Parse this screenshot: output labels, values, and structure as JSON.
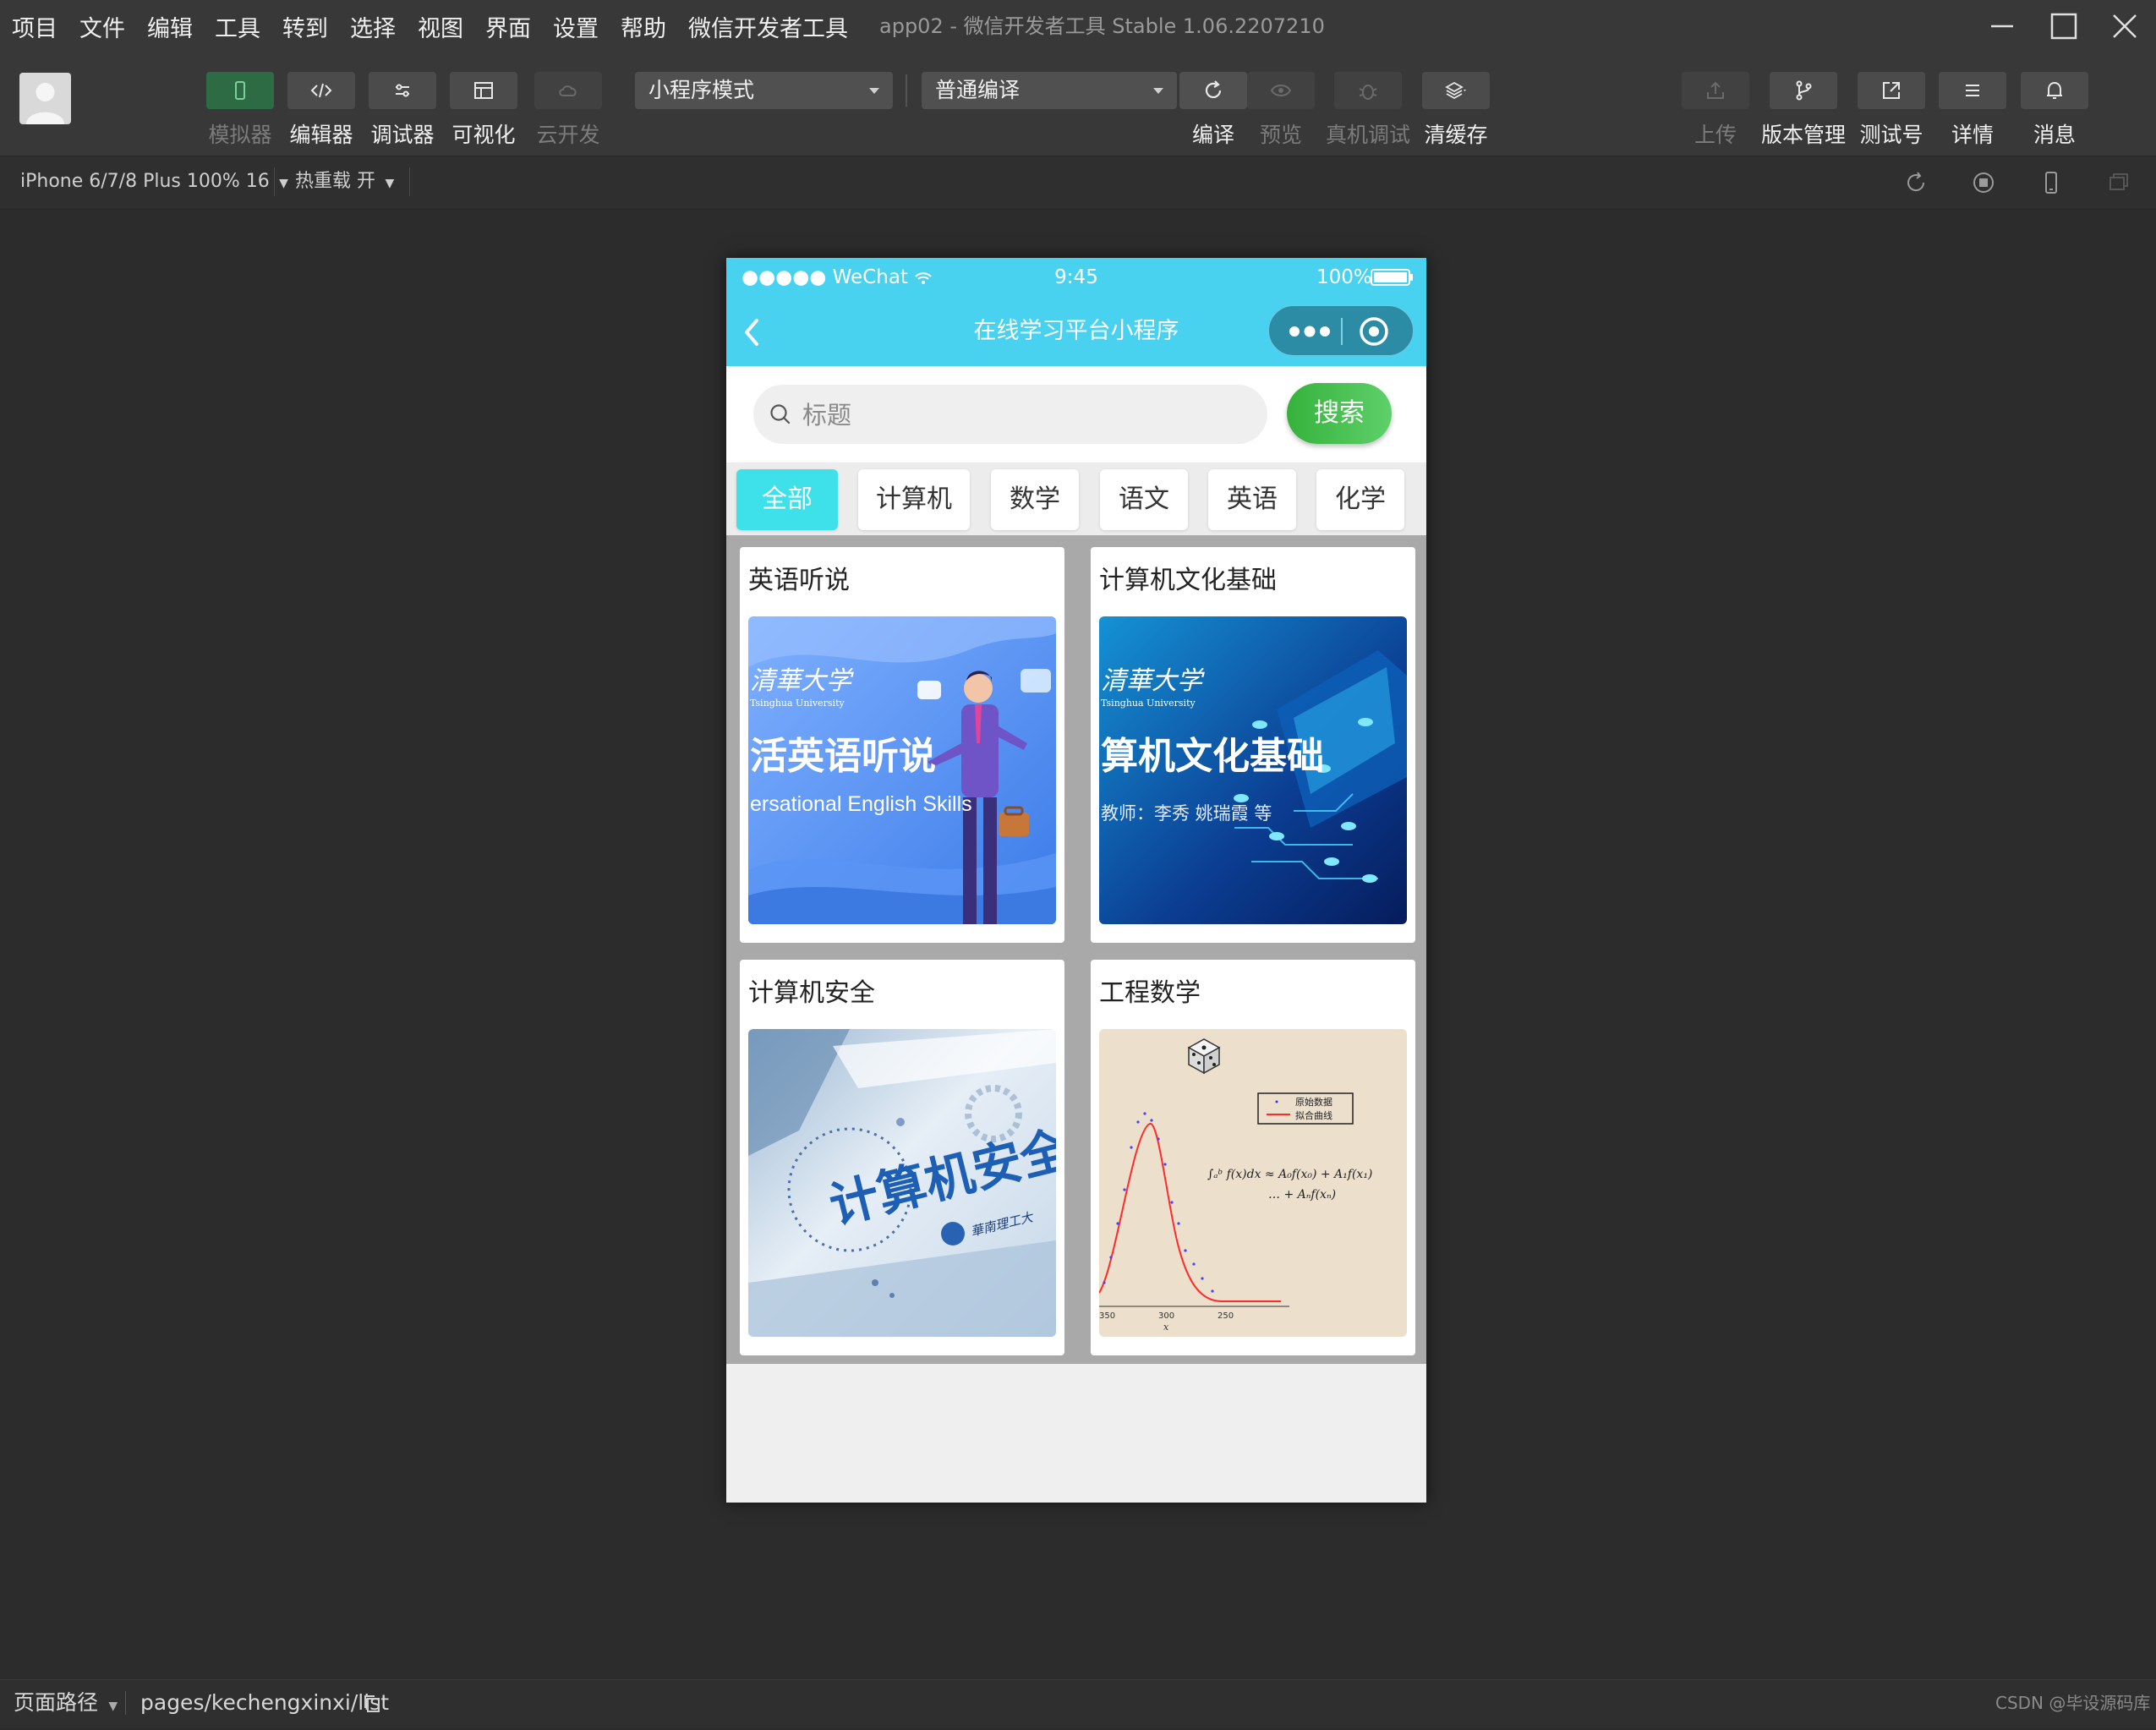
{
  "menubar": {
    "items": [
      "项目",
      "文件",
      "编辑",
      "工具",
      "转到",
      "选择",
      "视图",
      "界面",
      "设置",
      "帮助",
      "微信开发者工具"
    ],
    "window_title": "app02 - 微信开发者工具 Stable 1.06.2207210"
  },
  "toolbar": {
    "left_buttons": [
      {
        "label": "模拟器",
        "icon": "phone-icon",
        "active": true
      },
      {
        "label": "编辑器",
        "icon": "code-icon"
      },
      {
        "label": "调试器",
        "icon": "sliders-icon"
      },
      {
        "label": "可视化",
        "icon": "layout-icon"
      },
      {
        "label": "云开发",
        "icon": "cloud-icon",
        "disabled": true
      }
    ],
    "mode_select": "小程序模式",
    "compile_select": "普通编译",
    "mid_buttons": [
      {
        "label": "编译",
        "icon": "refresh-icon"
      },
      {
        "label": "预览",
        "icon": "eye-icon",
        "disabled": true
      },
      {
        "label": "真机调试",
        "icon": "bug-icon",
        "disabled": true
      },
      {
        "label": "清缓存",
        "icon": "layers-icon"
      }
    ],
    "right_buttons": [
      {
        "label": "上传",
        "icon": "upload-icon",
        "disabled": true
      },
      {
        "label": "版本管理",
        "icon": "branch-icon"
      },
      {
        "label": "测试号",
        "icon": "external-icon"
      },
      {
        "label": "详情",
        "icon": "menu-icon"
      },
      {
        "label": "消息",
        "icon": "bell-icon"
      }
    ]
  },
  "subbar": {
    "device": "iPhone 6/7/8 Plus 100% 16",
    "hot_reload": "热重载 开"
  },
  "phone": {
    "status": {
      "signal": "●●●●● WeChat",
      "time": "9:45",
      "battery": "100%"
    },
    "nav_title": "在线学习平台小程序",
    "search": {
      "placeholder": "标题",
      "button": "搜索"
    },
    "tabs": [
      "全部",
      "计算机",
      "数学",
      "语文",
      "英语",
      "化学"
    ],
    "active_tab": "全部",
    "cards": [
      {
        "title": "英语听说",
        "img_line1": "活英语听说",
        "img_line2": "ersational English Skills",
        "img_brand": "清華大学",
        "img_brand_en": "Tsinghua University"
      },
      {
        "title": "计算机文化基础",
        "img_line1": "算机文化基础",
        "img_line2": "教师：李秀 姚瑞霞 等",
        "img_brand": "清華大学",
        "img_brand_en": "Tsinghua University"
      },
      {
        "title": "计算机安全",
        "img_line1": "计算机安全",
        "img_brand": "華南理工大"
      },
      {
        "title": "工程数学",
        "img_legend1": "原始数据",
        "img_legend2": "拟合曲线",
        "img_formula1": "∫ₐᵇ f(x)dx ≈ A₀f(x₀) + A₁f(x₁)",
        "img_formula2": "… + Aₙf(xₙ)",
        "img_ticks": [
          "350",
          "300",
          "250"
        ],
        "img_axis": "x"
      }
    ]
  },
  "bottombar": {
    "path_label": "页面路径",
    "path": "pages/kechengxinxi/list",
    "watermark": "CSDN @毕设源码库"
  },
  "colors": {
    "accent": "#49d1f0",
    "tab_active": "#3ee0ea",
    "search_button": "#4cc152",
    "sim_button": "#2d6b45"
  }
}
